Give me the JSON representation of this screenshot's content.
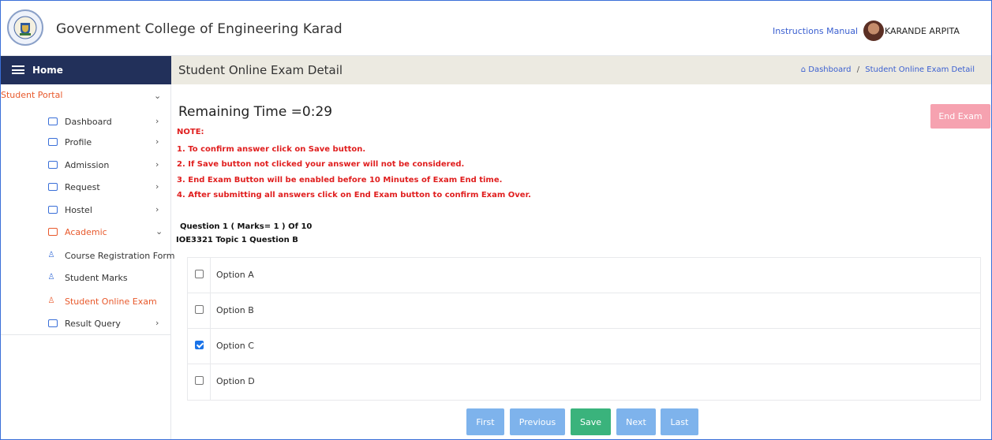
{
  "header": {
    "college_name": "Government College of Engineering Karad",
    "instructions_link": "Instructions Manual",
    "user_name": "KARANDE ARPITA"
  },
  "sidebar": {
    "home_label": "Home",
    "section_label": "Student Portal",
    "items": [
      {
        "label": "Dashboard"
      },
      {
        "label": "Profile"
      },
      {
        "label": "Admission"
      },
      {
        "label": "Request"
      },
      {
        "label": "Hostel"
      },
      {
        "label": "Academic"
      },
      {
        "label": "Result Query"
      }
    ],
    "academic_sub": [
      {
        "label": "Course Registration Form"
      },
      {
        "label": "Student Marks"
      },
      {
        "label": "Student Online Exam"
      }
    ]
  },
  "page": {
    "title": "Student Online Exam Detail",
    "breadcrumb": [
      "Dashboard",
      "Student Online Exam Detail"
    ]
  },
  "exam": {
    "remaining_time": "Remaining Time =0:29",
    "end_exam_label": "End Exam",
    "note_title": "NOTE:",
    "notes": [
      "1. To confirm answer click on Save button.",
      "2. If Save button not clicked your answer will not be considered.",
      "3. End Exam Button will be enabled before 10 Minutes of Exam End time.",
      "4. After submitting all answers click on End Exam button to confirm Exam Over."
    ],
    "question_title": "Question 1 ( Marks= 1 ) Of 10",
    "question_text": "IOE3321 Topic 1 Question B",
    "options": [
      {
        "label": "Option A",
        "checked": false
      },
      {
        "label": "Option B",
        "checked": false
      },
      {
        "label": "Option C",
        "checked": true
      },
      {
        "label": "Option D",
        "checked": false
      }
    ],
    "nav": {
      "first": "First",
      "previous": "Previous",
      "save": "Save",
      "next": "Next",
      "last": "Last"
    }
  },
  "colors": {
    "sidebar_header": "#22305a",
    "accent_orange": "#e8592c",
    "note_red": "#e01e1e",
    "save_green": "#3ab37c",
    "nav_blue": "#7eb3ec",
    "end_exam_pink": "#f6a2b0"
  }
}
